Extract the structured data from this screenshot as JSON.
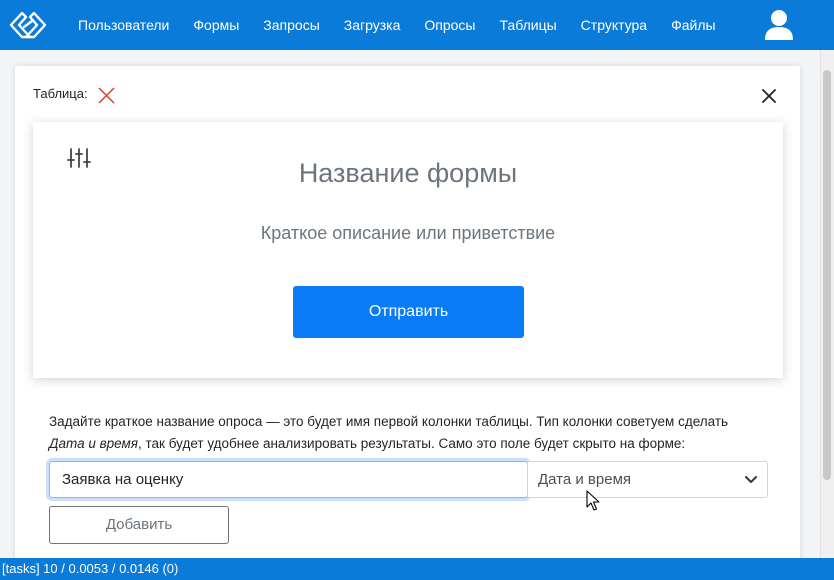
{
  "nav": {
    "items": [
      {
        "label": "Пользователи"
      },
      {
        "label": "Формы"
      },
      {
        "label": "Запросы"
      },
      {
        "label": "Загрузка"
      },
      {
        "label": "Опросы"
      },
      {
        "label": "Таблицы"
      },
      {
        "label": "Структура"
      },
      {
        "label": "Файлы"
      }
    ],
    "logo_icon": "logo-icon",
    "user_icon": "user-icon"
  },
  "modal": {
    "table_label": "Таблица:",
    "table_status_icon": "x-mark-icon",
    "close_icon": "close-icon",
    "preview": {
      "settings_icon": "sliders-icon",
      "title": "Название формы",
      "description": "Краткое описание или приветствие",
      "submit_label": "Отправить"
    },
    "hint": {
      "part1": "Задайте краткое название опроса — это будет имя первой колонки таблицы. Тип колонки советуем сделать",
      "emphasis": "Дата и время",
      "part2": ", так будет удобнее анализировать результаты. Само это поле будет скрыто на форме:"
    },
    "name_input_value": "Заявка на оценку",
    "type_select_value": "Дата и время",
    "add_button_label": "Добавить"
  },
  "status_bar": {
    "text": "[tasks] 10 / 0.0053 / 0.0146 (0)"
  },
  "colors": {
    "brand": "#0a7bd8",
    "primary_button": "#0a7bf7",
    "muted_text": "#6c757d",
    "x_mark": "#e0312f"
  }
}
